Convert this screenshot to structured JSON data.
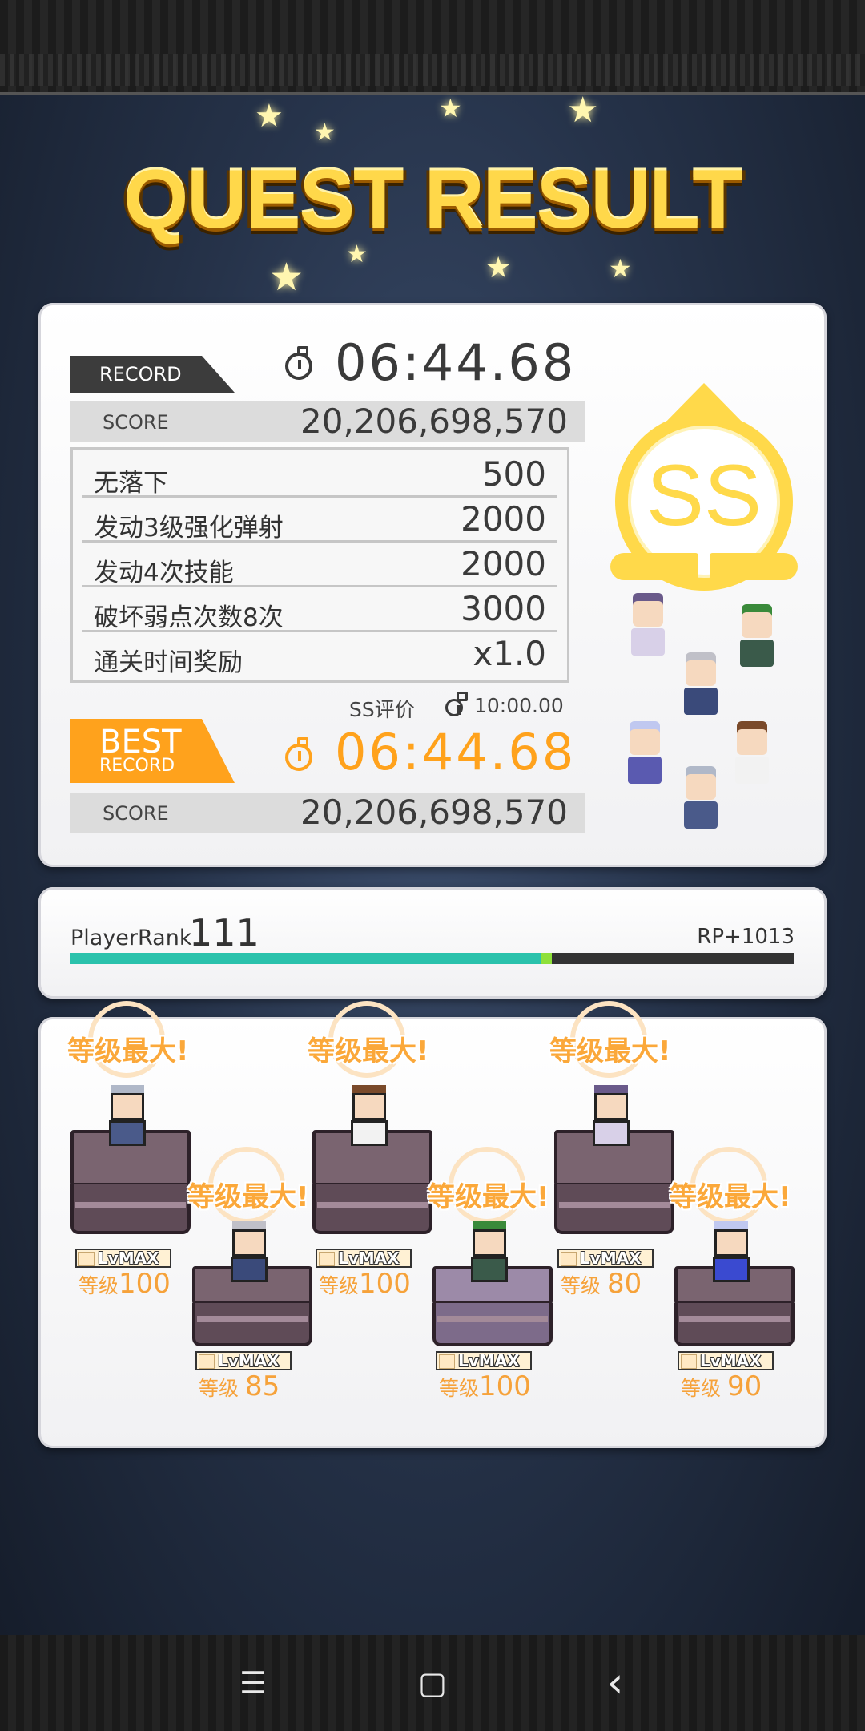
{
  "title": "QUEST RESULT",
  "record": {
    "tag": "RECORD",
    "time": "06:44.68",
    "score_label": "SCORE",
    "score": "20,206,698,570"
  },
  "bonuses": [
    {
      "name": "无落下",
      "value": "500"
    },
    {
      "name": "发动3级强化弹射",
      "value": "2000"
    },
    {
      "name": "发动4次技能",
      "value": "2000"
    },
    {
      "name": "破坏弱点次数8次",
      "value": "3000"
    },
    {
      "name": "通关时间奖励",
      "value": "x1.0"
    }
  ],
  "ss_condition": {
    "label": "SS评价",
    "time": "10:00.00"
  },
  "best": {
    "tag_main": "BEST",
    "tag_sub": "RECORD",
    "time": "06:44.68",
    "score_label": "SCORE",
    "score": "20,206,698,570"
  },
  "rank_grade": "SS",
  "player_rank": {
    "label": "PlayerRank",
    "value": "111",
    "rp": "RP+1013",
    "progress": 0.65
  },
  "units": [
    {
      "max_label": "等级最大!",
      "badge": "LvMAX",
      "level_prefix": "等级",
      "level": "100",
      "hair": "#b0b8c8",
      "body": "#4a5a8a"
    },
    {
      "max_label": "等级最大!",
      "badge": "LvMAX",
      "level_prefix": "等级",
      "level": "85",
      "hair": "#c0c0c8",
      "body": "#3a4a7a"
    },
    {
      "max_label": "等级最大!",
      "badge": "LvMAX",
      "level_prefix": "等级",
      "level": "100",
      "hair": "#7a4a2a",
      "body": "#f2f2f2"
    },
    {
      "max_label": "等级最大!",
      "badge": "LvMAX",
      "level_prefix": "等级",
      "level": "100",
      "hair": "#3a8a3a",
      "body": "#3a5a4a"
    },
    {
      "max_label": "等级最大!",
      "badge": "LvMAX",
      "level_prefix": "等级",
      "level": "80",
      "hair": "#6a5a8a",
      "body": "#d8d0e8"
    },
    {
      "max_label": "等级最大!",
      "badge": "LvMAX",
      "level_prefix": "等级",
      "level": "90",
      "hair": "#c0c8f0",
      "body": "#3a4ad0"
    }
  ],
  "nav": {
    "menu": "☰",
    "home": "▢",
    "back": "‹"
  },
  "colors": {
    "accent": "#ffa21c",
    "gold": "#ffd94a",
    "progress": "#2bc2ac"
  }
}
